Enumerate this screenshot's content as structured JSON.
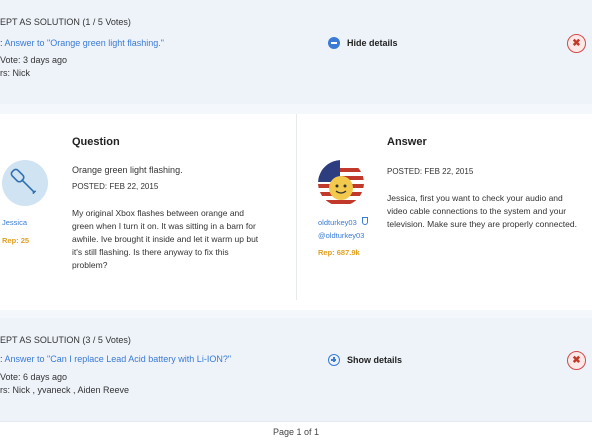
{
  "vote1": {
    "heading": "EPT AS SOLUTION (1 / 5 Votes)",
    "answer_prefix": ": ",
    "answer_link": "Answer to \"Orange green light flashing.\"",
    "vote_time": "Vote: 3 days ago",
    "voters": "rs: Nick",
    "toggle_label": "Hide details",
    "close_symbol": "✖"
  },
  "question": {
    "section_title": "Question",
    "title": "Orange green light flashing.",
    "posted": "POSTED: FEB 22, 2015",
    "body": "My original Xbox flashes between orange and green when I turn it on. It was sitting in a barn for awhile. Ive brought it inside and let it warm up but it's still flashing. Is there anyway to fix this problem?",
    "author": "Jessica",
    "rep": "Rep: 25"
  },
  "answer": {
    "section_title": "Answer",
    "posted": "POSTED: FEB 22, 2015",
    "body": "Jessica, first you want to check your audio and video cable connections to the system and your television. Make sure they are properly connected.",
    "author": "oldturkey03",
    "handle": "@oldturkey03",
    "rep": "Rep: 687.9k"
  },
  "vote2": {
    "heading": "EPT AS SOLUTION (3 / 5 Votes)",
    "answer_prefix": ": ",
    "answer_link": "Answer to \"Can I replace Lead Acid battery with Li-ION?\"",
    "vote_time": "Vote: 6 days ago",
    "voters": "rs: Nick , yvaneck , Aiden Reeve",
    "toggle_label": "Show details",
    "close_symbol": "✖"
  },
  "pagination": {
    "label": "Page 1 of 1"
  },
  "colors": {
    "link": "#3a7bd5",
    "rep": "#e0a020",
    "band": "#eef3fa",
    "close": "#d24a4a"
  }
}
